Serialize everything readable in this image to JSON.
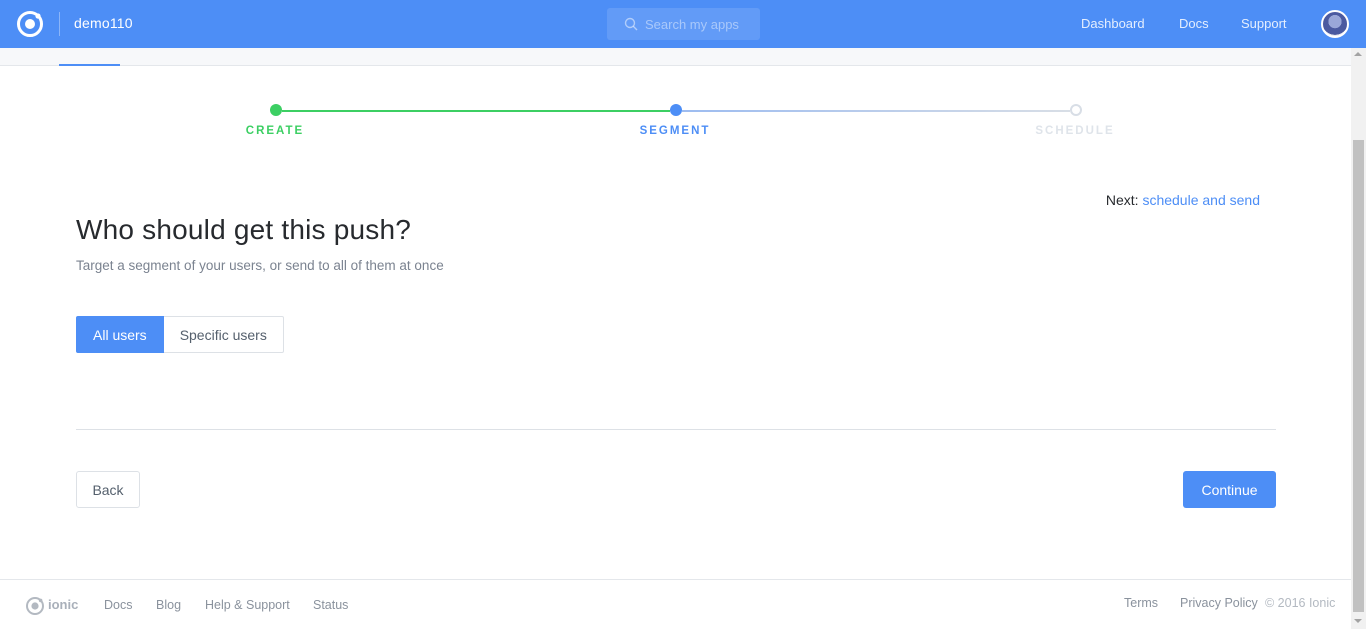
{
  "topbar": {
    "app_name": "demo110",
    "search_placeholder": "Search my apps",
    "nav": [
      "Dashboard",
      "Docs",
      "Support"
    ],
    "logo_icon": "ionic-logo-icon",
    "avatar": "user-avatar"
  },
  "steps": {
    "items": [
      {
        "label": "CREATE",
        "state": "complete"
      },
      {
        "label": "SEGMENT",
        "state": "current"
      },
      {
        "label": "SCHEDULE",
        "state": "upcoming"
      }
    ]
  },
  "next": {
    "prefix": "Next:",
    "link": "schedule and send"
  },
  "main": {
    "heading": "Who should get this push?",
    "subtitle": "Target a segment of your users, or send to all of them at once",
    "segment_options": [
      "All users",
      "Specific users"
    ],
    "selected": "All users"
  },
  "actions": {
    "back": "Back",
    "continue": "Continue"
  },
  "footer": {
    "brand": "ionic",
    "links": [
      "Docs",
      "Blog",
      "Help & Support",
      "Status"
    ],
    "right_links": [
      "Terms",
      "Privacy Policy"
    ],
    "copyright": "© 2016 Ionic"
  },
  "colors": {
    "primary": "#4d8ef6",
    "complete": "#3ccf63",
    "muted": "#c9d2dc"
  }
}
